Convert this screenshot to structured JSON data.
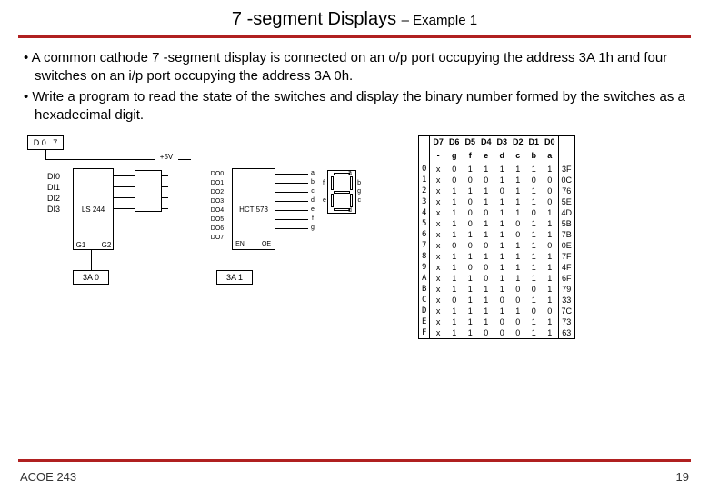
{
  "header": {
    "title_main": "7 -segment Displays",
    "title_sub": " – Example 1"
  },
  "bullets": [
    "A common cathode 7 -segment display is connected on an o/p port occupying the address 3A 1h and four switches on an i/p port occupying the address 3A 0h.",
    "Write a program to read the state of the switches and display the binary number formed by the switches as a hexadecimal digit."
  ],
  "diagram": {
    "bus_label": "D 0.. 7",
    "inputs": [
      "DI0",
      "DI1",
      "DI2",
      "DI3"
    ],
    "buffer_chip": "LS 244",
    "g1": "G1",
    "g2": "G2",
    "vcc": "+5V",
    "outputs": [
      "DO0",
      "DO1",
      "DO2",
      "DO3",
      "DO4",
      "DO5",
      "DO6",
      "DO7"
    ],
    "latch_chip": "HCT 573",
    "en": "EN",
    "oe": "OE",
    "addr_in": "3A 0",
    "addr_out": "3A 1",
    "seg_labels": [
      "a",
      "b",
      "c",
      "d",
      "e",
      "f",
      "g"
    ]
  },
  "table": {
    "headers_bits": [
      "D7",
      "D6",
      "D5",
      "D4",
      "D3",
      "D2",
      "D1",
      "D0"
    ],
    "headers_seg": [
      "-",
      "g",
      "f",
      "e",
      "d",
      "c",
      "b",
      "a"
    ],
    "rows": [
      {
        "digit": "0",
        "bits": [
          "x",
          "0",
          "1",
          "1",
          "1",
          "1",
          "1",
          "1"
        ],
        "hex": "3F"
      },
      {
        "digit": "1",
        "bits": [
          "x",
          "0",
          "0",
          "0",
          "1",
          "1",
          "0",
          "0"
        ],
        "hex": "0C"
      },
      {
        "digit": "2",
        "bits": [
          "x",
          "1",
          "1",
          "1",
          "0",
          "1",
          "1",
          "0"
        ],
        "hex": "76"
      },
      {
        "digit": "3",
        "bits": [
          "x",
          "1",
          "0",
          "1",
          "1",
          "1",
          "1",
          "0"
        ],
        "hex": "5E"
      },
      {
        "digit": "4",
        "bits": [
          "x",
          "1",
          "0",
          "0",
          "1",
          "1",
          "0",
          "1"
        ],
        "hex": "4D"
      },
      {
        "digit": "5",
        "bits": [
          "x",
          "1",
          "0",
          "1",
          "1",
          "0",
          "1",
          "1"
        ],
        "hex": "5B"
      },
      {
        "digit": "6",
        "bits": [
          "x",
          "1",
          "1",
          "1",
          "1",
          "0",
          "1",
          "1"
        ],
        "hex": "7B"
      },
      {
        "digit": "7",
        "bits": [
          "x",
          "0",
          "0",
          "0",
          "1",
          "1",
          "1",
          "0"
        ],
        "hex": "0E"
      },
      {
        "digit": "8",
        "bits": [
          "x",
          "1",
          "1",
          "1",
          "1",
          "1",
          "1",
          "1"
        ],
        "hex": "7F"
      },
      {
        "digit": "9",
        "bits": [
          "x",
          "1",
          "0",
          "0",
          "1",
          "1",
          "1",
          "1"
        ],
        "hex": "4F"
      },
      {
        "digit": "A",
        "bits": [
          "x",
          "1",
          "1",
          "0",
          "1",
          "1",
          "1",
          "1"
        ],
        "hex": "6F"
      },
      {
        "digit": "B",
        "bits": [
          "x",
          "1",
          "1",
          "1",
          "1",
          "0",
          "0",
          "1"
        ],
        "hex": "79"
      },
      {
        "digit": "C",
        "bits": [
          "x",
          "0",
          "1",
          "1",
          "0",
          "0",
          "1",
          "1"
        ],
        "hex": "33"
      },
      {
        "digit": "D",
        "bits": [
          "x",
          "1",
          "1",
          "1",
          "1",
          "1",
          "0",
          "0"
        ],
        "hex": "7C"
      },
      {
        "digit": "E",
        "bits": [
          "x",
          "1",
          "1",
          "1",
          "0",
          "0",
          "1",
          "1"
        ],
        "hex": "73"
      },
      {
        "digit": "F",
        "bits": [
          "x",
          "1",
          "1",
          "0",
          "0",
          "0",
          "1",
          "1"
        ],
        "hex": "63"
      }
    ]
  },
  "footer": {
    "left": "ACOE 243",
    "right": "19"
  }
}
